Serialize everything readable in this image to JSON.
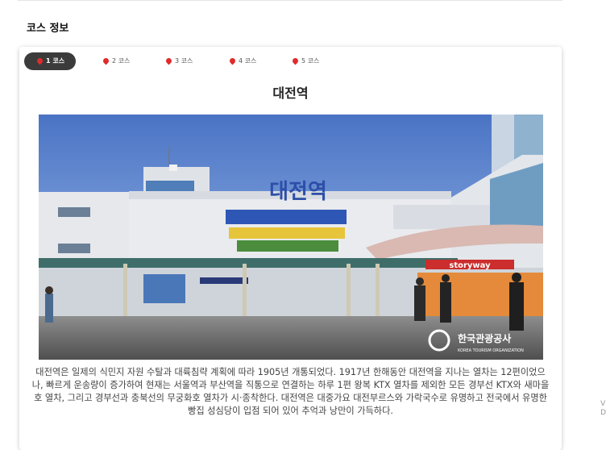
{
  "section": {
    "title": "코스 정보"
  },
  "tabs": [
    {
      "label": "1 코스",
      "active": true
    },
    {
      "label": "2 코스",
      "active": false
    },
    {
      "label": "3 코스",
      "active": false
    },
    {
      "label": "4 코스",
      "active": false
    },
    {
      "label": "5 코스",
      "active": false
    }
  ],
  "place": {
    "name": "대전역",
    "photo": {
      "station_sign": "대전역",
      "brand_sign": "storyway",
      "watermark_ko": "한국관광공사",
      "watermark_en": "KOREA TOURISM ORGANIZATION",
      "icon": "station-photo"
    },
    "description": "대전역은 일제의 식민지 자원 수탈과 대륙침략 계획에 따라 1905년 개통되었다. 1917년 한해동안 대전역을 지나는 열차는 12편이었으나, 빠르게 운송량이 증가하여 현재는 서울역과 부산역을 직통으로 연결하는 하루 1편 왕복 KTX 열차를 제외한 모든 경부선 KTX와 새마을호 열차, 그리고 경부선과 충북선의 무궁화호 열차가 시·종착한다. 대전역은 대중가요 대전부르스와 가락국수로 유명하고 전국에서 유명한 빵집 성심당이 입점 되어 있어 추억과 낭만이 가득하다."
  },
  "colors": {
    "tab_active_bg": "#3b3b3b",
    "pin": "#e02b2b",
    "sky": "#5f87cf"
  }
}
